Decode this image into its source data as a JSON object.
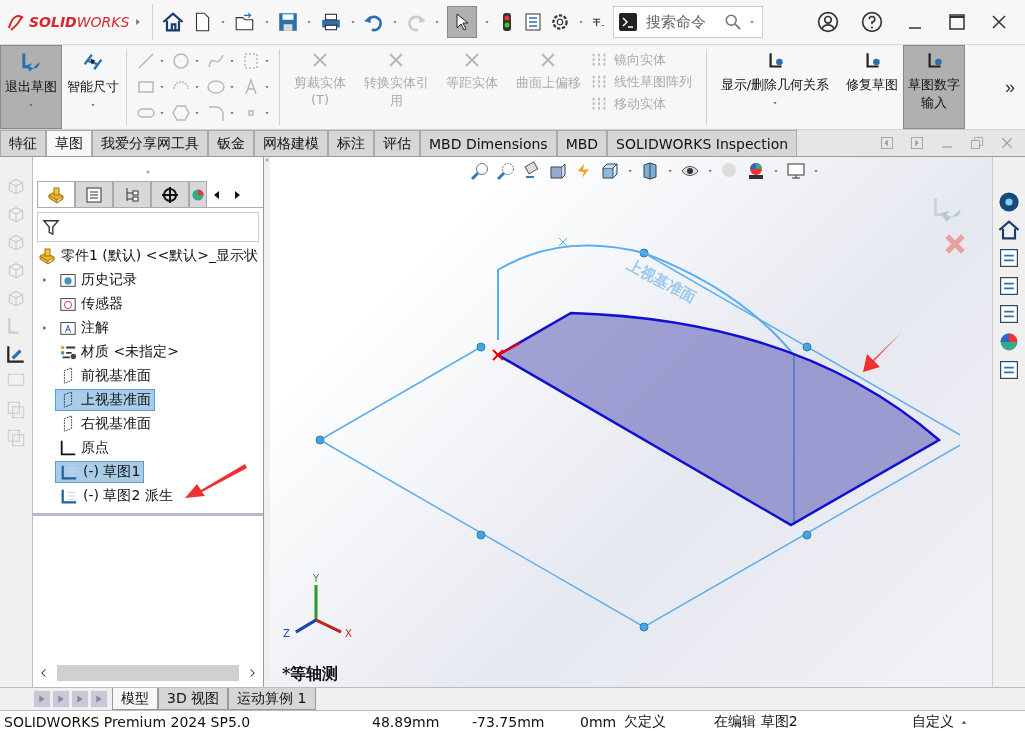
{
  "app": {
    "logo": "**SOLID**WORKS"
  },
  "search": {
    "placeholder": "搜索命令"
  },
  "ribbon": {
    "primary": [
      {
        "label": "退出草图",
        "selected": true
      },
      {
        "label": "智能尺寸",
        "selected": false
      }
    ],
    "tools": [
      {
        "label": "剪裁实体(T)",
        "disabled": true
      },
      {
        "label": "转换实体引用",
        "disabled": true
      },
      {
        "label": "等距实体",
        "disabled": true
      },
      {
        "label": "曲面上偏移",
        "disabled": true
      }
    ],
    "list": [
      {
        "label": "镜向实体",
        "disabled": true
      },
      {
        "label": "线性草图阵列",
        "disabled": true
      },
      {
        "label": "移动实体",
        "disabled": true
      }
    ],
    "secondary": [
      {
        "label": "显示/删除几何关系",
        "selected": false
      },
      {
        "label": "修复草图",
        "selected": false
      },
      {
        "label": "草图数字输入",
        "selected": true
      }
    ],
    "more": "»"
  },
  "tabs": [
    {
      "label": "特征",
      "selected": false
    },
    {
      "label": "草图",
      "selected": true
    },
    {
      "label": "我爱分享网工具",
      "selected": false
    },
    {
      "label": "钣金",
      "selected": false
    },
    {
      "label": "网格建模",
      "selected": false
    },
    {
      "label": "标注",
      "selected": false
    },
    {
      "label": "评估",
      "selected": false
    },
    {
      "label": "MBD Dimensions",
      "selected": false
    },
    {
      "label": "MBD",
      "selected": false
    },
    {
      "label": "SOLIDWORKS Inspection",
      "selected": false
    }
  ],
  "tree": {
    "root": "零件1 (默认) <<默认>_显示状",
    "items": [
      {
        "label": "历史记录",
        "kind": "history",
        "expandable": true,
        "selected": false
      },
      {
        "label": "传感器",
        "kind": "sensor",
        "expandable": false,
        "selected": false
      },
      {
        "label": "注解",
        "kind": "annotation",
        "expandable": true,
        "selected": false
      },
      {
        "label": "材质 <未指定>",
        "kind": "material",
        "expandable": false,
        "selected": false
      },
      {
        "label": "前视基准面",
        "kind": "plane",
        "expandable": false,
        "selected": false
      },
      {
        "label": "上视基准面",
        "kind": "plane",
        "expandable": false,
        "selected": true
      },
      {
        "label": "右视基准面",
        "kind": "plane",
        "expandable": false,
        "selected": false
      },
      {
        "label": "原点",
        "kind": "origin",
        "expandable": false,
        "selected": false
      },
      {
        "label": "(-) 草图1",
        "kind": "sketch",
        "expandable": false,
        "selected": true
      },
      {
        "label": "(-) 草图2 派生",
        "kind": "sketch",
        "expandable": false,
        "selected": false
      }
    ]
  },
  "bottom_tabs": [
    {
      "label": "模型",
      "selected": true
    },
    {
      "label": "3D 视图",
      "selected": false
    },
    {
      "label": "运动算例 1",
      "selected": false
    }
  ],
  "viewport": {
    "view_name": "*等轴测",
    "plane_label": "上视基准面",
    "axes": [
      "X",
      "Y",
      "Z"
    ]
  },
  "status_bar": {
    "product": "SOLIDWORKS Premium 2024 SP5.0",
    "x": "48.89mm",
    "y": "-73.75mm",
    "z": "0mm",
    "state": "欠定义",
    "editing": "在编辑 草图2",
    "units": "自定义"
  }
}
